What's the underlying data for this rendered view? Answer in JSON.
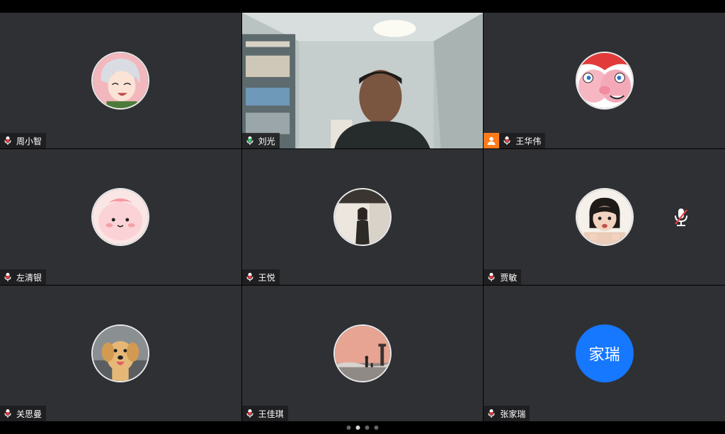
{
  "participants": [
    {
      "name": "周小智",
      "avatar_icon": "anime-boy-avatar"
    },
    {
      "name": "刘光",
      "video": true,
      "mic_color": "#39c46a"
    },
    {
      "name": "王华伟",
      "host": true,
      "avatar_icon": "cartoon-pig-avatar"
    },
    {
      "name": "左清银",
      "avatar_icon": "pink-blob-avatar"
    },
    {
      "name": "王悦",
      "avatar_icon": "photo-woman-avatar"
    },
    {
      "name": "贾敏",
      "avatar_icon": "photo-child-avatar",
      "muted": true
    },
    {
      "name": "关思曼",
      "avatar_icon": "dog-avatar"
    },
    {
      "name": "王佳琪",
      "avatar_icon": "sunset-photo-avatar"
    },
    {
      "name": "张家瑞",
      "avatar_text": "家瑞",
      "avatar_color": "#1677ff"
    }
  ],
  "pager": {
    "pages": 4,
    "current": 2
  },
  "colors": {
    "tile_bg": "#2f3033",
    "active_border": "#1fb85c",
    "mic_red": "#e04040",
    "host_badge": "#ff7a1a"
  }
}
